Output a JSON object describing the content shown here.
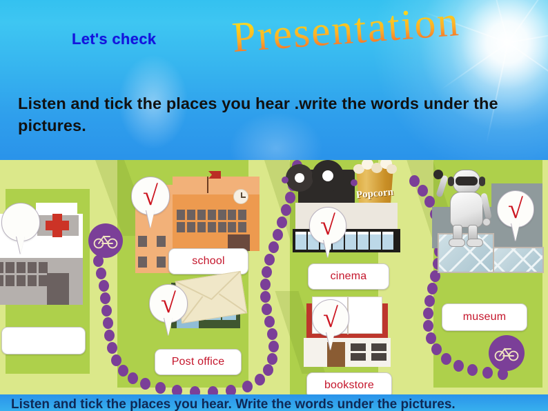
{
  "header": {
    "lets_check_label": "Let's check",
    "title_wordart": "Presentation",
    "instruction": "Listen and tick the places you hear .write the words under the pictures."
  },
  "colors": {
    "sky_top": "#34c1f0",
    "sky_bottom": "#2a93ea",
    "lets_check_color": "#1414dd",
    "wordart_top": "#ffe02e",
    "wordart_bottom": "#ef4b22",
    "instruction_color": "#111111",
    "map_base_green": "#dbe88a",
    "map_block_green": "#aed04b",
    "road_dot_purple": "#7b3f98",
    "label_text_red": "#c4152b",
    "tick_red": "#cc1520",
    "school_orange": "#f0a868",
    "post_office_green": "#4d6238",
    "bookstore_red": "#c0392f",
    "hospital_gray": "#b5b0ad",
    "hospital_cross_red": "#cc3326",
    "museum_platform_gray": "#8f9a9c",
    "popcorn_gold": "#d6a02c"
  },
  "map": {
    "places": [
      {
        "id": "hospital",
        "icon": "hospital-building-icon",
        "label": "",
        "checked": false,
        "label_placeholder": ""
      },
      {
        "id": "school",
        "icon": "school-building-icon",
        "label": "school",
        "checked": true
      },
      {
        "id": "post-office",
        "icon": "post-office-building-icon",
        "label": "Post office",
        "checked": true
      },
      {
        "id": "cinema",
        "icon": "cinema-building-icon",
        "label": "cinema",
        "checked": true
      },
      {
        "id": "bookstore",
        "icon": "bookstore-building-icon",
        "label": "bookstore",
        "checked": true
      },
      {
        "id": "museum",
        "icon": "museum-building-icon",
        "label": "museum",
        "checked": true
      }
    ],
    "popcorn_label": "Popcorn",
    "tick_glyph": "√",
    "bike_badges": 2
  },
  "bottom_strip": {
    "text": "Listen and tick the places you hear. Write the words under the pictures."
  }
}
